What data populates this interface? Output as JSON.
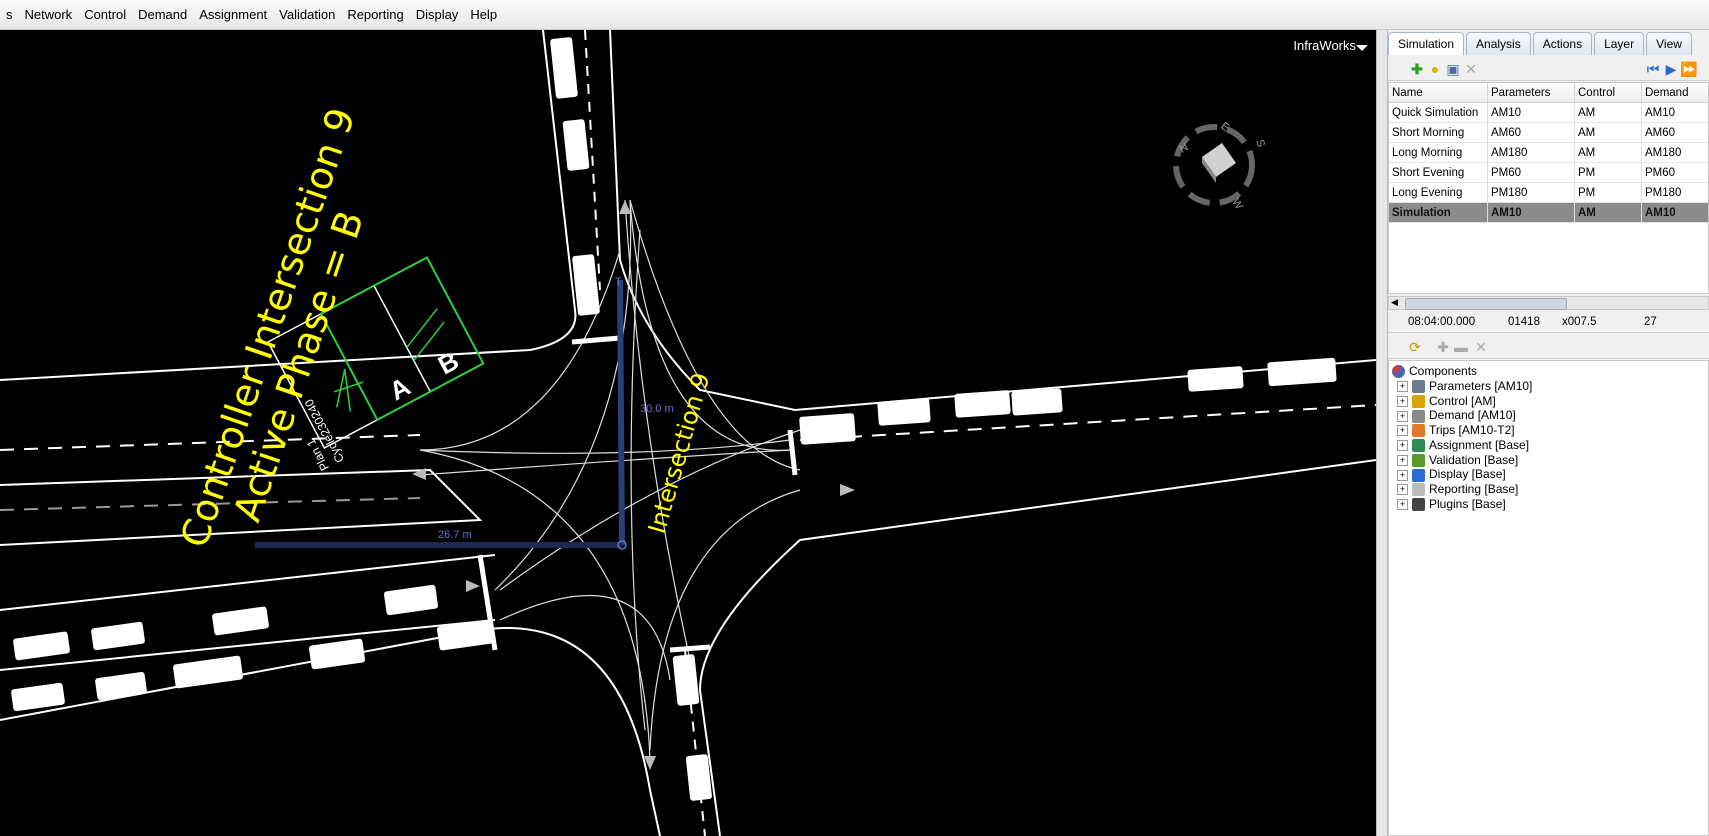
{
  "menu": [
    "s",
    "Network",
    "Control",
    "Demand",
    "Assignment",
    "Validation",
    "Reporting",
    "Display",
    "Help"
  ],
  "viewport": {
    "brand": "InfraWorks",
    "overlay_line1": "Controller Intersection 9",
    "overlay_line2": "Active Phase = B",
    "intersection_label": "Intersection 9",
    "dim_vertical": "30.0 m",
    "dim_horizontal": "26.7 m",
    "plan_text": "Plan 1",
    "cycle_text": "Cycle230240",
    "phase_a": "A",
    "phase_b": "B",
    "compass": {
      "n": "N",
      "e": "E",
      "s": "S",
      "w": "W"
    }
  },
  "panel": {
    "tabs": [
      {
        "label": "Simulation",
        "active": true
      },
      {
        "label": "Analysis",
        "active": false
      },
      {
        "label": "Actions",
        "active": false
      },
      {
        "label": "Layer",
        "active": false
      },
      {
        "label": "View",
        "active": false
      }
    ],
    "columns": [
      "Name",
      "Parameters",
      "Control",
      "Demand"
    ],
    "rows": [
      [
        "Quick Simulation",
        "AM10",
        "AM",
        "AM10"
      ],
      [
        "Short Morning",
        "AM60",
        "AM",
        "AM60"
      ],
      [
        "Long Morning",
        "AM180",
        "AM",
        "AM180"
      ],
      [
        "Short Evening",
        "PM60",
        "PM",
        "PM60"
      ],
      [
        "Long Evening",
        "PM180",
        "PM",
        "PM180"
      ],
      [
        "Simulation",
        "AM10",
        "AM",
        "AM10"
      ]
    ],
    "selected_row": 5,
    "status": {
      "time": "08:04:00.000",
      "count": "01418",
      "speed": "x007.5",
      "vehicles": "27"
    },
    "tree_root": "Components",
    "tree_items": [
      {
        "label": "Parameters [AM10]",
        "icon": "parameters-icon",
        "color": "#6b7a8c"
      },
      {
        "label": "Control [AM]",
        "icon": "traffic-light-icon",
        "color": "#d9a400"
      },
      {
        "label": "Demand [AM10]",
        "icon": "demand-icon",
        "color": "#8a8a8a"
      },
      {
        "label": "Trips [AM10-T2]",
        "icon": "trips-icon",
        "color": "#e07a2a"
      },
      {
        "label": "Assignment [Base]",
        "icon": "assignment-icon",
        "color": "#2e8b57"
      },
      {
        "label": "Validation [Base]",
        "icon": "validation-icon",
        "color": "#5a9a2a"
      },
      {
        "label": "Display [Base]",
        "icon": "display-icon",
        "color": "#2a6bd1"
      },
      {
        "label": "Reporting [Base]",
        "icon": "reporting-icon",
        "color": "#bbbbbb"
      },
      {
        "label": "Plugins [Base]",
        "icon": "plugins-icon",
        "color": "#444444"
      }
    ]
  }
}
